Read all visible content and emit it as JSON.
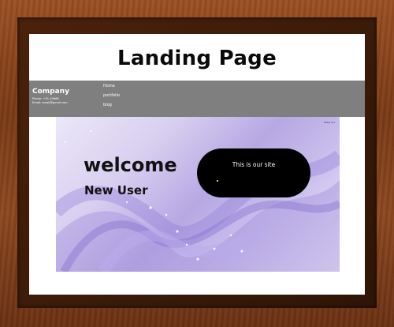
{
  "page": {
    "heading": "Landing Page"
  },
  "header": {
    "company": "Company",
    "phone": "Phone: +91 45666",
    "email": "Email: email@gmail.com",
    "nav": [
      "Home",
      "portfolio",
      "blog"
    ]
  },
  "hero": {
    "corner_label": "Slider 0.5",
    "welcome": "welcome",
    "subtitle": "New User",
    "pill_text": "This is our site"
  },
  "colors": {
    "navbar": "#7f7f7f",
    "pill": "#000000",
    "frame": "#8c4720"
  }
}
